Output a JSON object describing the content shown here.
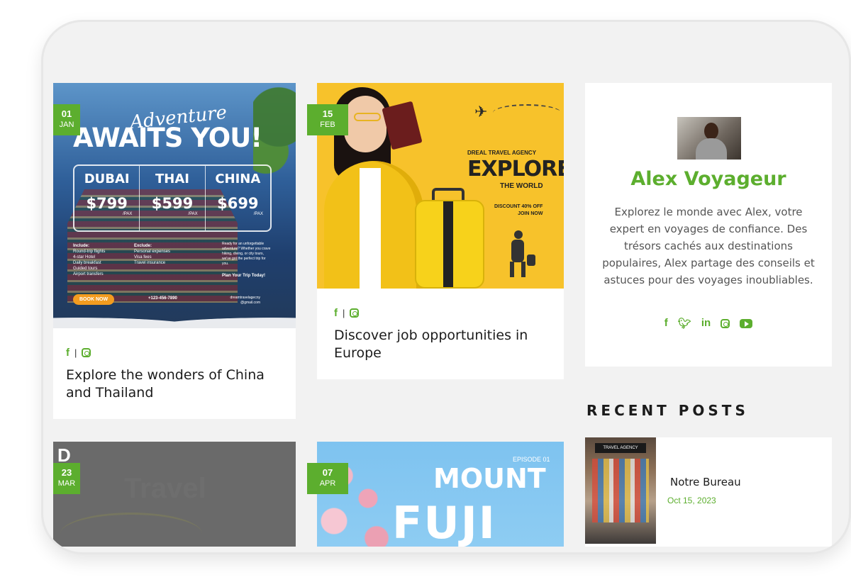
{
  "posts": [
    {
      "date_day": "01",
      "date_month": "JAN",
      "title": "Explore the wonders of China and Thailand",
      "image": {
        "script_title": "Adventure",
        "headline": "AWAITS YOU!",
        "destinations": [
          {
            "name": "DUBAI",
            "price": "$799",
            "unit": "/PAX"
          },
          {
            "name": "THAI",
            "price": "$599",
            "unit": "/PAX"
          },
          {
            "name": "CHINA",
            "price": "$699",
            "unit": "/PAX"
          }
        ],
        "include_label": "Include:",
        "include_items": [
          "Round-trip flights",
          "4-star Hotel",
          "Daily breakfast",
          "Guided tours",
          "Airport transfers"
        ],
        "exclude_label": "Exclude:",
        "exclude_items": [
          "Personal expenses",
          "Visa fees",
          "Travel insurance"
        ],
        "blurb": "Ready for an unforgettable adventure? Whether you crave hiking, diving, or city tours, we've got the perfect trip for you.",
        "plan": "Plan Your Trip Today!",
        "book": "BOOK NOW",
        "phone": "+123-456-7890",
        "email": "dreamtravelagecny @gmail.com"
      }
    },
    {
      "date_day": "15",
      "date_month": "FEB",
      "title": "Discover job opportunities in Europe",
      "image": {
        "brand": "DREAL TRAVEL AGENCY",
        "headline": "EXPLORE",
        "subline": "THE WORLD",
        "discount": "DISCOUNT 40% OFF",
        "cta": "JOIN NOW"
      }
    },
    {
      "date_day": "23",
      "date_month": "MAR",
      "image": {
        "logo": "D"
      }
    },
    {
      "date_day": "07",
      "date_month": "APR",
      "image": {
        "episode": "EPISODE 01",
        "line1": "MOUNT",
        "line2": "FUJI"
      }
    }
  ],
  "author": {
    "name": "Alex Voyageur",
    "bio": "Explorez le monde avec Alex, votre expert en voyages de confiance. Des trésors cachés aux destinations populaires, Alex partage des conseils et astuces pour des voyages inoubliables.",
    "social_icons": [
      "facebook-icon",
      "twitter-icon",
      "linkedin-icon",
      "instagram-icon",
      "youtube-icon"
    ]
  },
  "recent_posts": {
    "heading": "RECENT POSTS",
    "items": [
      {
        "title": "Notre Bureau",
        "date": "Oct 15, 2023",
        "thumb_sign": "TRAVEL AGENCY"
      }
    ]
  },
  "share": {
    "facebook": "f",
    "separator": "|"
  },
  "colors": {
    "accent": "#5cae2e",
    "background": "#f2f2f2"
  }
}
